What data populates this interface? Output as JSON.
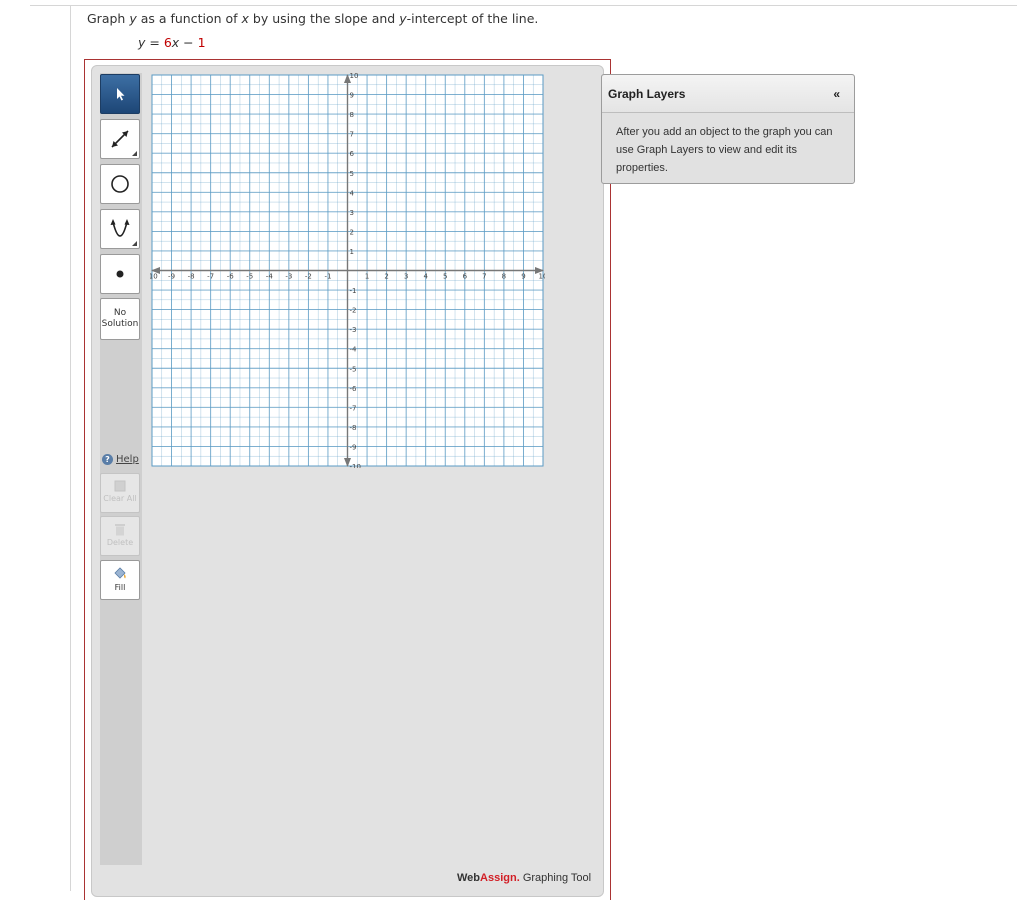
{
  "question": {
    "text_1": "Graph ",
    "var_y": "y",
    "text_2": " as a function of ",
    "var_x": "x",
    "text_3": " by using the slope and ",
    "var_y2": "y",
    "text_4": "-intercept of the line."
  },
  "equation": {
    "lhs": "y",
    "eq": " = ",
    "coef": "6",
    "var": "x",
    "op": " − ",
    "const": "1"
  },
  "toolbar": {
    "no_solution_line1": "No",
    "no_solution_line2": "Solution",
    "help": "Help",
    "clear_all": "Clear All",
    "delete": "Delete",
    "fill": "Fill"
  },
  "graph": {
    "x_range": [
      -10,
      10
    ],
    "y_range": [
      -10,
      10
    ],
    "minor_step": 0.5,
    "major_step": 1,
    "grid_color": "#5b9bc4",
    "tick_labels_x": [
      "-10",
      "-9",
      "-8",
      "-7",
      "-6",
      "-5",
      "-4",
      "-3",
      "-2",
      "-1",
      "1",
      "2",
      "3",
      "4",
      "5",
      "6",
      "7",
      "8",
      "9",
      "10"
    ],
    "tick_labels_y": [
      "10",
      "9",
      "8",
      "7",
      "6",
      "5",
      "4",
      "3",
      "2",
      "1",
      "-1",
      "-2",
      "-3",
      "-4",
      "-5",
      "-6",
      "-7",
      "-8",
      "-9",
      "-10"
    ]
  },
  "layers": {
    "title": "Graph Layers",
    "collapse": "«",
    "message": "After you add an object to the graph you can use Graph Layers to view and edit its properties."
  },
  "brand": {
    "web": "Web",
    "assign": "Assign.",
    "tool": " Graphing Tool"
  },
  "colors": {
    "accent_red": "#c00000",
    "active_tool": "#1d4676",
    "brand_red": "#d21f26"
  }
}
